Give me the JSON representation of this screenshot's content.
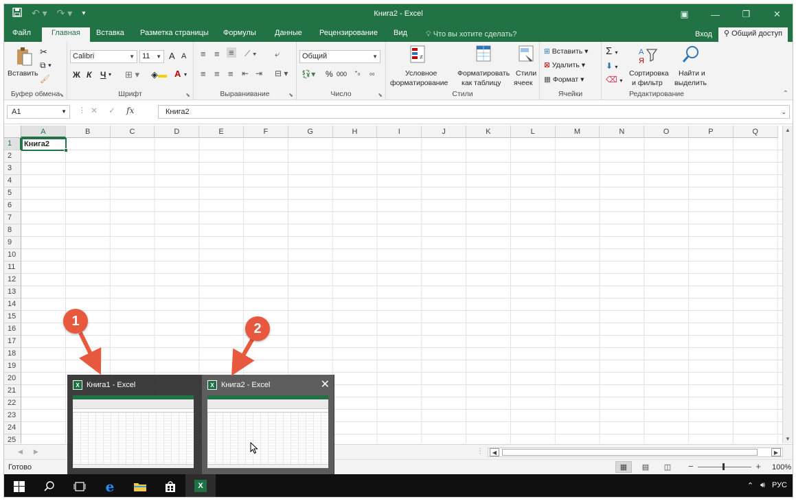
{
  "window": {
    "title": "Книга2 - Excel"
  },
  "tabs": {
    "file": "Файл",
    "home": "Главная",
    "insert": "Вставка",
    "layout": "Разметка страницы",
    "formulas": "Формулы",
    "data": "Данные",
    "review": "Рецензирование",
    "view": "Вид",
    "tell_me": "Что вы хотите сделать?",
    "sign_in": "Вход",
    "share": "Общий доступ"
  },
  "ribbon": {
    "clipboard": {
      "paste": "Вставить",
      "label": "Буфер обмена"
    },
    "font": {
      "name": "Calibri",
      "size": "11",
      "bold": "Ж",
      "italic": "К",
      "underline": "Ч",
      "grow": "A",
      "shrink": "A",
      "color": "A",
      "label": "Шрифт"
    },
    "alignment": {
      "label": "Выравнивание"
    },
    "number": {
      "format": "Общий",
      "percent": "%",
      "thousands": "000",
      "label": "Число"
    },
    "styles": {
      "conditional_1": "Условное",
      "conditional_2": "форматирование",
      "table_1": "Форматировать",
      "table_2": "как таблицу",
      "cell_1": "Стили",
      "cell_2": "ячеек",
      "label": "Стили"
    },
    "cells": {
      "insert": "Вставить",
      "delete": "Удалить",
      "format": "Формат",
      "label": "Ячейки"
    },
    "editing": {
      "sort_1": "Сортировка",
      "sort_2": "и фильтр",
      "find_1": "Найти и",
      "find_2": "выделить",
      "label": "Редактирование"
    }
  },
  "formula_bar": {
    "name_box": "A1",
    "fx": "fx",
    "content": "Книга2"
  },
  "grid": {
    "columns": [
      "A",
      "B",
      "C",
      "D",
      "E",
      "F",
      "G",
      "H",
      "I",
      "J",
      "K",
      "L",
      "M",
      "N",
      "O",
      "P",
      "Q"
    ],
    "rows": [
      "1",
      "2",
      "3",
      "4",
      "5",
      "6",
      "7",
      "8",
      "9",
      "10",
      "11",
      "12",
      "13",
      "14",
      "15",
      "16",
      "17",
      "18",
      "19",
      "20",
      "21",
      "22",
      "23",
      "24",
      "25"
    ],
    "a1_value": "Книга2"
  },
  "status": {
    "ready": "Готово",
    "zoom": "100%"
  },
  "taskbar": {
    "excel_label": "X",
    "tray_lang": "РУС"
  },
  "preview": {
    "book1": "Книга1 - Excel",
    "book2": "Книга2 - Excel",
    "badge": "X"
  },
  "markers": [
    "1",
    "2"
  ],
  "colors": {
    "excel_green": "#217346",
    "marker": "#e8583e"
  }
}
